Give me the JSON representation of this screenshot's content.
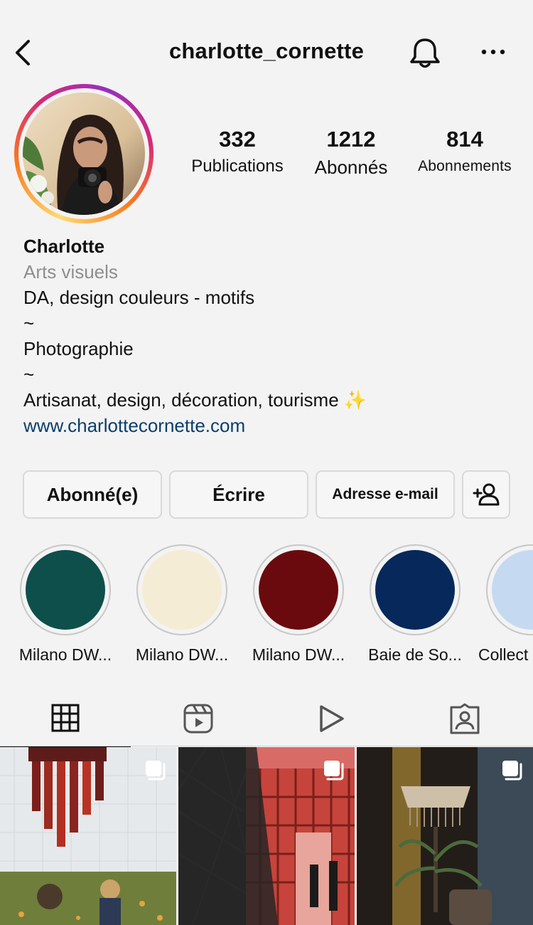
{
  "header": {
    "username": "charlotte_cornette"
  },
  "icons": {
    "back": "chevron-left-icon",
    "bell": "bell-icon",
    "more": "more-horizontal-icon",
    "add_user": "add-user-icon",
    "grid": "grid-icon",
    "reels": "reels-icon",
    "video": "play-icon",
    "tagged": "tagged-icon",
    "multi": "multiple-posts-icon"
  },
  "stats": [
    {
      "value": "332",
      "label": "Publications"
    },
    {
      "value": "1212",
      "label": "Abonnés"
    },
    {
      "value": "814",
      "label": "Abonnements"
    }
  ],
  "bio": {
    "name": "Charlotte",
    "category": "Arts visuels",
    "lines": [
      "DA, design couleurs - motifs",
      "~",
      "Photographie",
      "~",
      "Artisanat, design, décoration, tourisme ✨"
    ],
    "link": "www.charlottecornette.com"
  },
  "actions": {
    "following": "Abonné(e)",
    "message": "Écrire",
    "email": "Adresse e-mail"
  },
  "highlights": [
    {
      "label": "Milano DW...",
      "color": "#0e4f4b"
    },
    {
      "label": "Milano DW...",
      "color": "#f5ecd6"
    },
    {
      "label": "Milano DW...",
      "color": "#6a0a0e"
    },
    {
      "label": "Baie de So...",
      "color": "#06285a"
    },
    {
      "label": "Collect",
      "color": "#c5d9f1"
    }
  ],
  "colors": {
    "background": "#f3f3f3",
    "link": "#0b3d6b",
    "muted": "#8e8e8e"
  }
}
